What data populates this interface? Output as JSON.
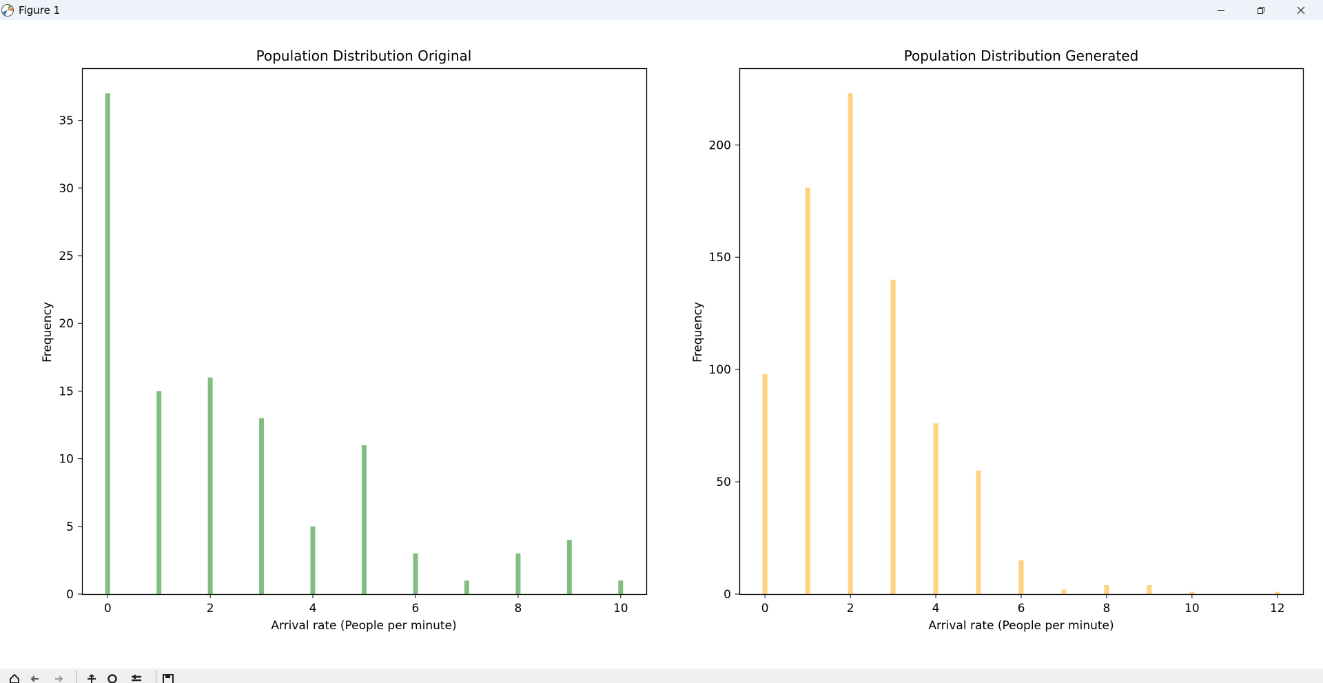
{
  "window": {
    "title": "Figure 1"
  },
  "colors": {
    "left_bars": "#80bf80",
    "right_bars": "#ffd280"
  },
  "chart_data": [
    {
      "type": "bar",
      "title": "Population Distribution Original",
      "xlabel": "Arrival rate (People per minute)",
      "ylabel": "Frequency",
      "x": [
        0,
        1,
        2,
        3,
        4,
        5,
        6,
        7,
        8,
        9,
        10
      ],
      "values": [
        37,
        15,
        16,
        13,
        5,
        11,
        3,
        1,
        3,
        4,
        1
      ],
      "xlim": [
        -0.5,
        10.5
      ],
      "ylim": [
        0,
        38.85
      ],
      "xticks": [
        "0",
        "2",
        "4",
        "6",
        "8",
        "10"
      ],
      "yticks": [
        "0",
        "5",
        "10",
        "15",
        "20",
        "25",
        "30",
        "35"
      ],
      "grid": false
    },
    {
      "type": "bar",
      "title": "Population Distribution Generated",
      "xlabel": "Arrival rate (People per minute)",
      "ylabel": "Frequency",
      "x": [
        0,
        1,
        2,
        3,
        4,
        5,
        6,
        7,
        8,
        9,
        10,
        12
      ],
      "values": [
        98,
        181,
        223,
        140,
        76,
        55,
        15,
        2,
        4,
        4,
        1,
        1
      ],
      "xlim": [
        -0.6,
        12.6
      ],
      "ylim": [
        0,
        234.15
      ],
      "xticks": [
        "0",
        "2",
        "4",
        "6",
        "8",
        "10",
        "12"
      ],
      "yticks": [
        "0",
        "50",
        "100",
        "150",
        "200"
      ],
      "grid": false
    }
  ]
}
